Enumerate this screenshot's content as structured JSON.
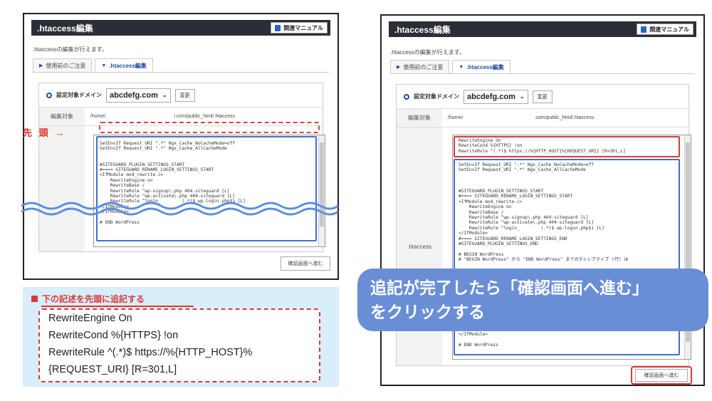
{
  "left": {
    "title": ".htaccess編集",
    "manual_label": "関連マニュアル",
    "description": ".htaccessの編集が行えます。",
    "tabs": [
      "使用前のご注意",
      ".htaccess編集"
    ],
    "domain_label": "設定対象ドメイン",
    "domain_value": "abcdefg.com",
    "change_label": "変更",
    "path_label": "編集対象",
    "path_prefix": "/home/",
    "path_suffix": "i.com/public_html/.htaccess",
    "code": "SetEnvIf Request_URI \".*\" Ngx_Cache_NoCacheMode=off\nSetEnvIf Request_URI \".*\" Ngx_Cache_AllCacheMode\n\n\n#SITEGUARD_PLUGIN_SETTINGS_START\n#==== SITEGUARD_RENAME_LOGIN_SETTINGS_START\n<IfModule mod_rewrite.c>\n    RewriteEngine on\n    RewriteBase /\n    RewriteRule ^wp-signup\\.php 404-siteguard [L]\n    RewriteRule ^wp-activate\\.php 404-siteguard [L]\n    RewriteRule ^login_        (.*)$ wp-login.php$1 [L]\n</IfModule>\n</IfModule>\n\n# END WordPress",
    "confirm_label": "確認画面へ進む",
    "head_label": "先 頭 →"
  },
  "snippet": {
    "heading": "下の記述を先頭に追記する",
    "lines": [
      "RewriteEngine On",
      "RewriteCond %{HTTPS} !on",
      "RewriteRule ^(.*)$ https://%{HTTP_HOST}%",
      "{REQUEST_URI} [R=301,L]"
    ]
  },
  "right": {
    "title": ".htaccess編集",
    "manual_label": "関連マニュアル",
    "description": ".htaccessの編集が行えます。",
    "tabs": [
      "使用前のご注意",
      ".htaccess編集"
    ],
    "domain_label": "設定対象ドメイン",
    "domain_value": "abcdefg.com",
    "change_label": "変更",
    "path_label": "編集対象",
    "path_prefix": "/home/",
    "path_suffix": ".com/public_html/.htaccess",
    "row_label": ".htaccess",
    "added_code": "RewriteEngine On\nRewriteCond %{HTTPS} !on\nRewriteRule ^(.*)$ https://%{HTTP_HOST}%{REQUEST_URI} [R=301,L]",
    "code": "SetEnvIf Request_URI \".*\" Ngx_Cache_NoCacheMode=off\nSetEnvIf Request_URI \".*\" Ngx_Cache_AllCacheMode\n\n\n\n#SITEGUARD_PLUGIN_SETTINGS_START\n#==== SITEGUARD_RENAME_LOGIN_SETTINGS_START\n<IfModule mod_rewrite.c>\n    RewriteEngine on\n    RewriteBase /\n    RewriteRule ^wp-signup\\.php 404-siteguard [L]\n    RewriteRule ^wp-activate\\.php 404-siteguard [L]\n    RewriteRule ^login_        (.*)$ wp-login.php$1 [L]\n</IfModule>\n#==== SITEGUARD_RENAME_LOGIN_SETTINGS_END\n#SITEGUARD_PLUGIN_SETTINGS_END\n\n# BEGIN WordPress\n# \"BEGIN WordPress\" から \"END WordPress\" までのディレクティブ (行) は",
    "code_tail": "</IfModule>\n\n# END WordPress",
    "confirm_label": "確認画面へ進む"
  },
  "callout": {
    "line1": "追記が完了したら「確認画面へ進む」",
    "line2": "をクリックする"
  },
  "colors": {
    "titlebar": "#2b2e36",
    "accent_blue": "#3f6fd0",
    "highlight_red": "#d83a3a",
    "callout_bg": "#6a8ed6",
    "snippet_bg": "#d9eefb"
  }
}
